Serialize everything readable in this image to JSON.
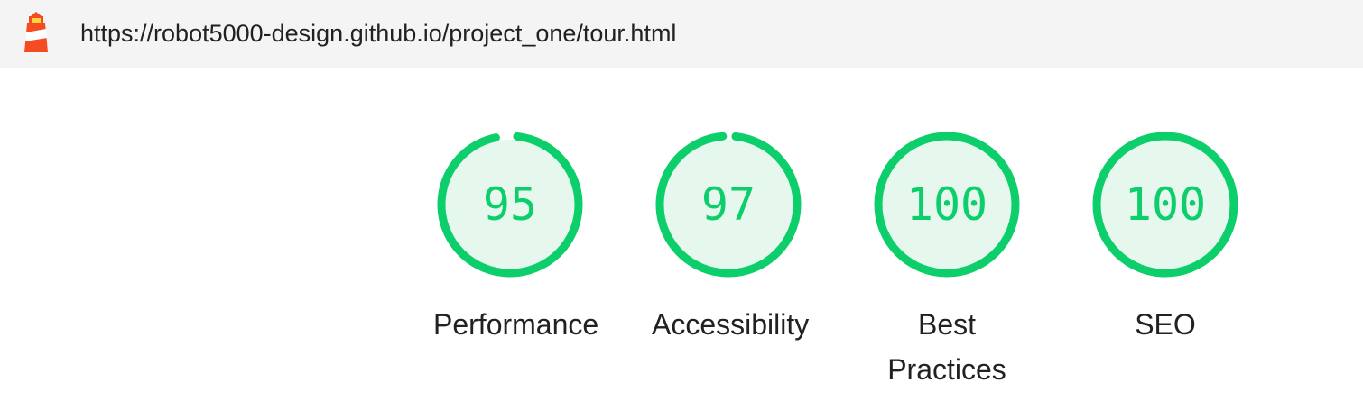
{
  "browser": {
    "url": "https://robot5000-design.github.io/project_one/tour.html"
  },
  "colors": {
    "pass_green": "#0cce6b",
    "pass_fill": "#e6f8ee",
    "topbar_bg": "#f4f4f4",
    "logo_orange": "#f44b21"
  },
  "scores": [
    {
      "value": 95,
      "display": "95",
      "label": "Performance"
    },
    {
      "value": 97,
      "display": "97",
      "label": "Accessibility"
    },
    {
      "value": 100,
      "display": "100",
      "label": "Best Practices"
    },
    {
      "value": 100,
      "display": "100",
      "label": "SEO"
    }
  ]
}
